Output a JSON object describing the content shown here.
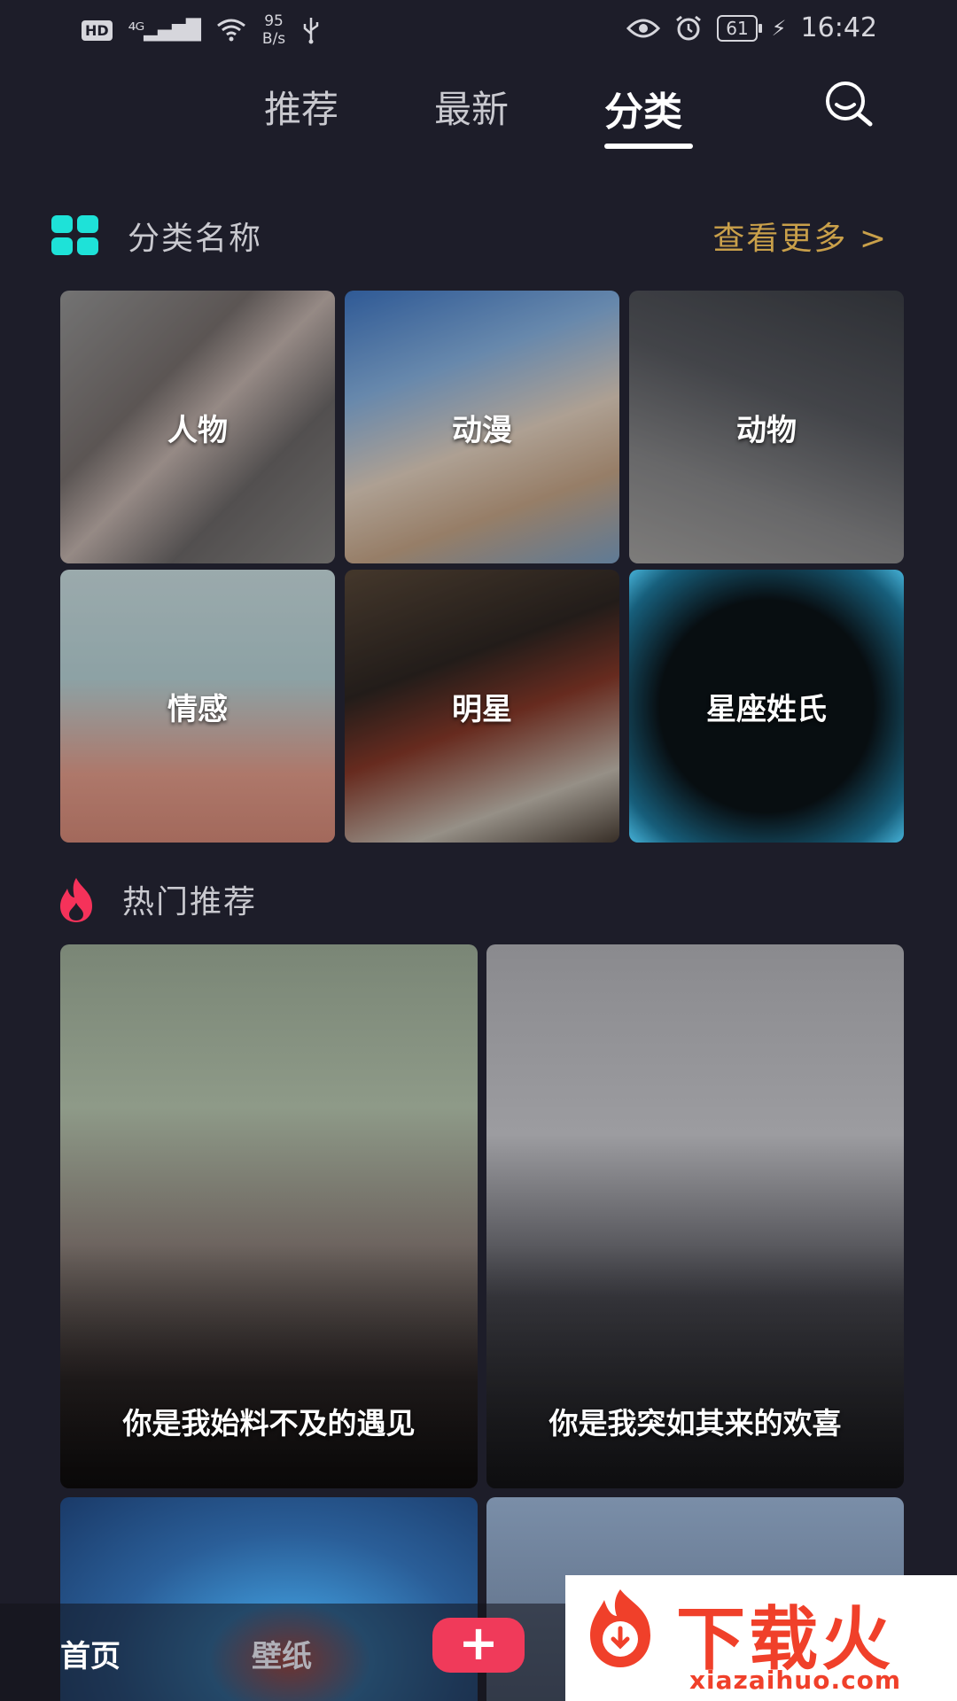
{
  "status_bar": {
    "hd": "HD",
    "network": "⁴ᴳ",
    "speed_value": "95",
    "speed_unit": "B/s",
    "battery": "61",
    "time": "16:42"
  },
  "tabs": [
    {
      "label": "推荐"
    },
    {
      "label": "最新"
    },
    {
      "label": "分类",
      "active": true
    }
  ],
  "category_section": {
    "title": "分类名称",
    "more": "查看更多 >",
    "items": [
      {
        "label": "人物"
      },
      {
        "label": "动漫"
      },
      {
        "label": "动物"
      },
      {
        "label": "情感"
      },
      {
        "label": "明星"
      },
      {
        "label": "星座姓氏"
      }
    ]
  },
  "hot_section": {
    "title": "热门推荐",
    "items": [
      {
        "caption": "你是我始料不及的遇见"
      },
      {
        "caption": "你是我突如其来的欢喜"
      }
    ]
  },
  "bottom_nav": {
    "home": "首页",
    "wallpaper": "壁纸",
    "add": "+"
  },
  "watermark": {
    "text": "下载火",
    "url": "xiazaihuo.com"
  },
  "colors": {
    "background": "#1d1d29",
    "accent_teal": "#1ee2d8",
    "more_gold": "#c9a04a",
    "add_red": "#f03a5a"
  }
}
